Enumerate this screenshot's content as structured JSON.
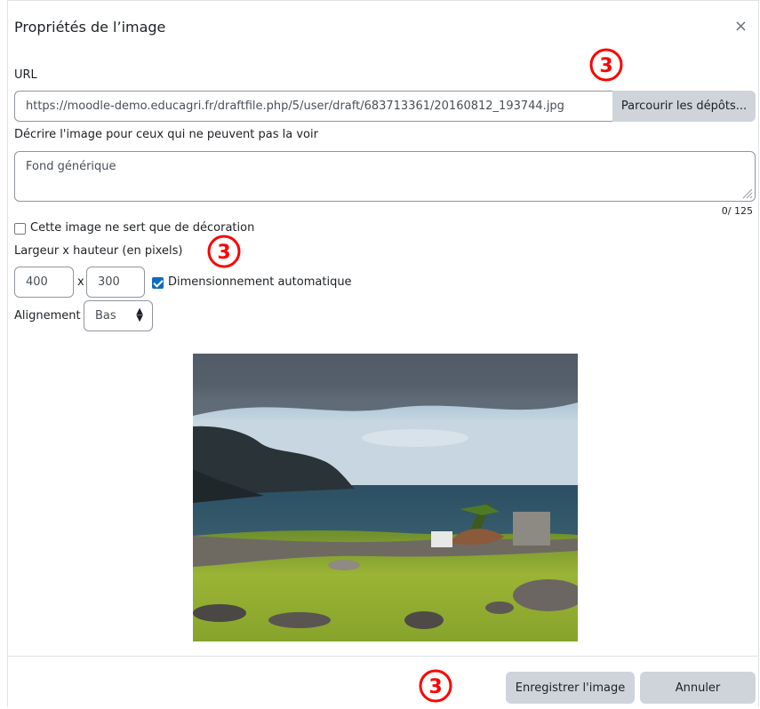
{
  "dialog": {
    "title": "Propriétés de l’image",
    "close_glyph": "×"
  },
  "url": {
    "label": "URL",
    "value": "https://moodle-demo.educagri.fr/draftfile.php/5/user/draft/683713361/20160812_193744.jpg",
    "browse_label": "Parcourir les dépôts..."
  },
  "description": {
    "label": "Décrire l'image pour ceux qui ne peuvent pas la voir",
    "value": "Fond générique",
    "counter": "0/ 125"
  },
  "decorative": {
    "label": "Cette image ne sert que de décoration",
    "checked": false
  },
  "size": {
    "label": "Largeur x hauteur (en pixels)",
    "width": "400",
    "separator": "x",
    "height": "300",
    "auto_label": "Dimensionnement automatique",
    "auto_checked": true
  },
  "alignment": {
    "label": "Alignement",
    "value": "Bas"
  },
  "footer": {
    "save_label": "Enregistrer l'image",
    "cancel_label": "Annuler"
  },
  "annotations": [
    "3",
    "3",
    "3"
  ],
  "colors": {
    "accent": "#0f6cbf",
    "button_bg": "#ced4da",
    "annotation_red": "#ff0000"
  },
  "icons": {
    "close": "close-icon",
    "select": "sort-arrows-icon",
    "resize": "resize-grip-icon"
  }
}
